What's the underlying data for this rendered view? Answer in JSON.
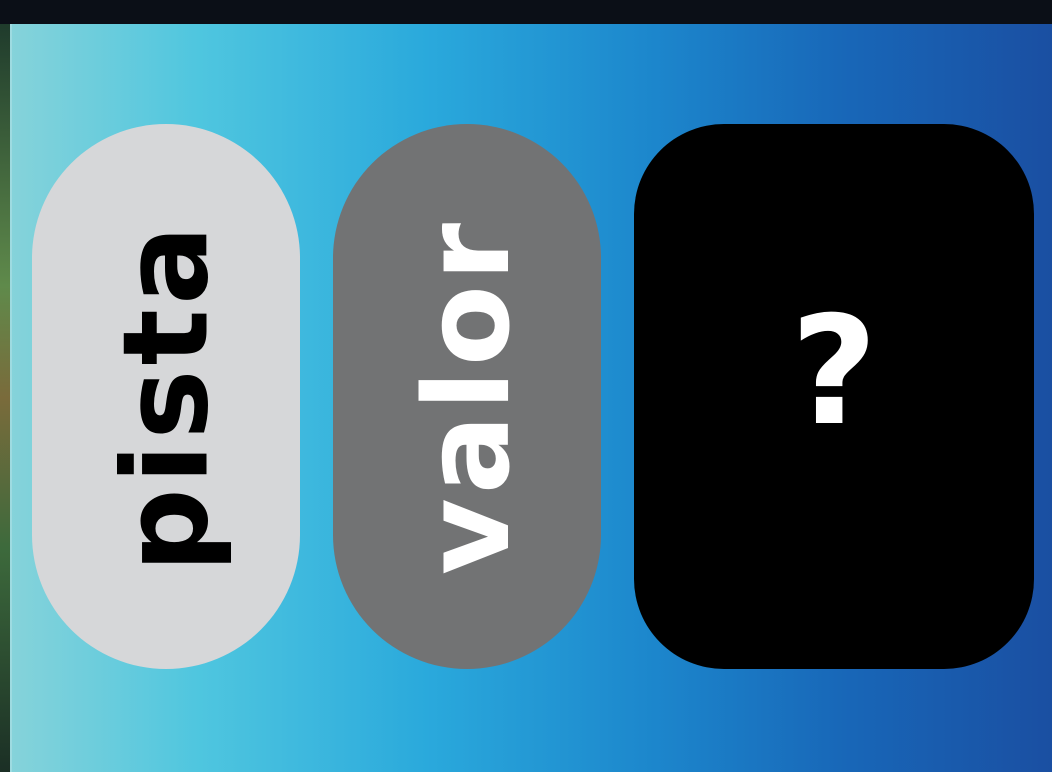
{
  "cards": [
    {
      "label": "pista",
      "background": "#d6d7d9",
      "text_color": "#000000"
    },
    {
      "label": "valor",
      "background": "#727374",
      "text_color": "#ffffff"
    },
    {
      "label": "?",
      "background": "#000000",
      "text_color": "#ffffff"
    }
  ],
  "colors": {
    "panel_gradient_start": "#86d3da",
    "panel_gradient_end": "#1a4fa2",
    "top_bar": "#0b0f17"
  }
}
